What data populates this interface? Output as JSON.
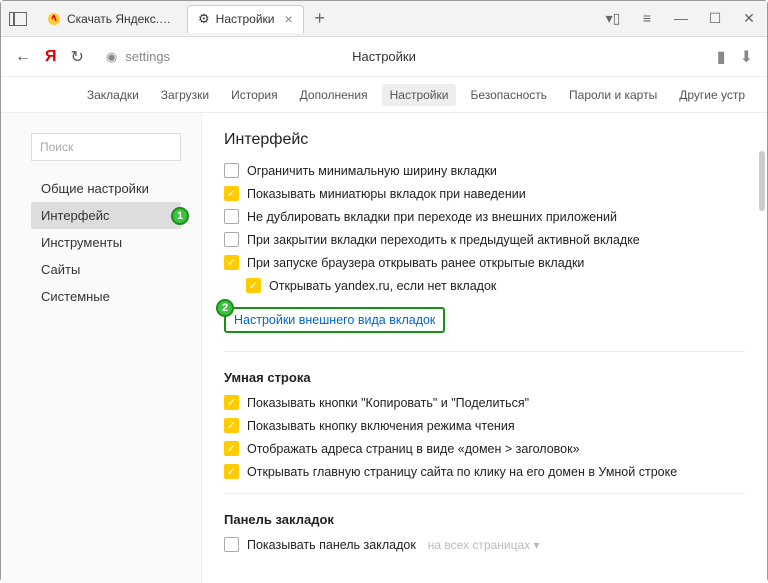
{
  "tabs": [
    {
      "label": "Скачать Яндекс.Браузер д"
    },
    {
      "label": "Настройки"
    }
  ],
  "url_hint": "settings",
  "url_title": "Настройки",
  "ribbon": [
    "Закладки",
    "Загрузки",
    "История",
    "Дополнения",
    "Настройки",
    "Безопасность",
    "Пароли и карты",
    "Другие устр"
  ],
  "ribbon_sel": 4,
  "search_placeholder": "Поиск",
  "side": [
    "Общие настройки",
    "Интерфейс",
    "Инструменты",
    "Сайты",
    "Системные"
  ],
  "side_sel": 1,
  "h_interface": "Интерфейс",
  "opts1": [
    {
      "c": false,
      "t": "Ограничить минимальную ширину вкладки"
    },
    {
      "c": true,
      "t": "Показывать миниатюры вкладок при наведении"
    },
    {
      "c": false,
      "t": "Не дублировать вкладки при переходе из внешних приложений"
    },
    {
      "c": false,
      "t": "При закрытии вкладки переходить к предыдущей активной вкладке"
    },
    {
      "c": true,
      "t": "При запуске браузера открывать ранее открытые вкладки"
    },
    {
      "c": true,
      "t": "Открывать yandex.ru, если нет вкладок",
      "indent": true
    }
  ],
  "link": "Настройки внешнего вида вкладок",
  "h_smart": "Умная строка",
  "opts2": [
    {
      "c": true,
      "t": "Показывать кнопки \"Копировать\" и \"Поделиться\""
    },
    {
      "c": true,
      "t": "Показывать кнопку включения режима чтения"
    },
    {
      "c": true,
      "t": "Отображать адреса страниц в виде «домен > заголовок»"
    },
    {
      "c": true,
      "t": "Открывать главную страницу сайта по клику на его домен в Умной строке"
    }
  ],
  "h_bm": "Панель закладок",
  "opts3": [
    {
      "c": false,
      "t": "Показывать панель закладок",
      "hint": "на всех страницах ▾"
    }
  ],
  "badge1": "1",
  "badge2": "2"
}
